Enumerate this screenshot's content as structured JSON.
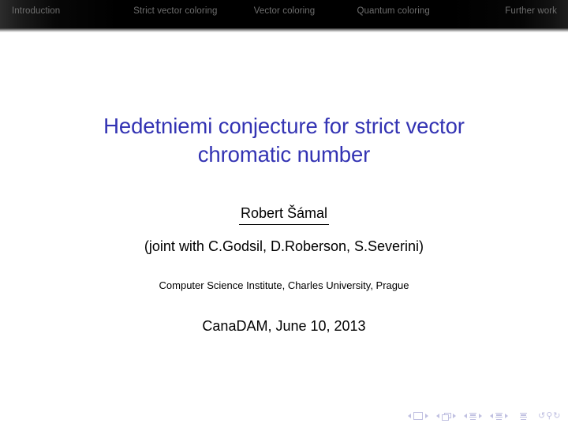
{
  "navbar": {
    "items": [
      {
        "label": "Introduction"
      },
      {
        "label": "Strict vector coloring"
      },
      {
        "label": "Vector coloring"
      },
      {
        "label": "Quantum coloring"
      },
      {
        "label": "Further work"
      }
    ],
    "background_color": "#000000",
    "text_color": "#6e6e6e"
  },
  "title": {
    "line1": "Hedetniemi conjecture for strict vector",
    "line2": "chromatic number",
    "color": "#3333b3"
  },
  "author": {
    "name": "Robert Šámal",
    "joint": "(joint with C.Godsil, D.Roberson, S.Severini)"
  },
  "institute": {
    "text": "Computer Science Institute, Charles University, Prague"
  },
  "date": {
    "text": "CanaDAM, June 10, 2013"
  },
  "navigation_symbols": {
    "color": "#9a9ad0",
    "groups": [
      {
        "name": "slide",
        "prev": "◀",
        "icon": "slide-icon",
        "next": "▶"
      },
      {
        "name": "frame",
        "prev": "◀",
        "icon": "frame-icon",
        "next": "▶"
      },
      {
        "name": "subsection",
        "prev": "◀",
        "icon": "subsection-icon",
        "next": "▶"
      },
      {
        "name": "section",
        "prev": "◀",
        "icon": "section-icon",
        "next": "▶"
      }
    ],
    "presentation_icon": "presentation-icon",
    "back_icon": "↺",
    "search_icon": "⚲",
    "forward_icon": "↻"
  }
}
